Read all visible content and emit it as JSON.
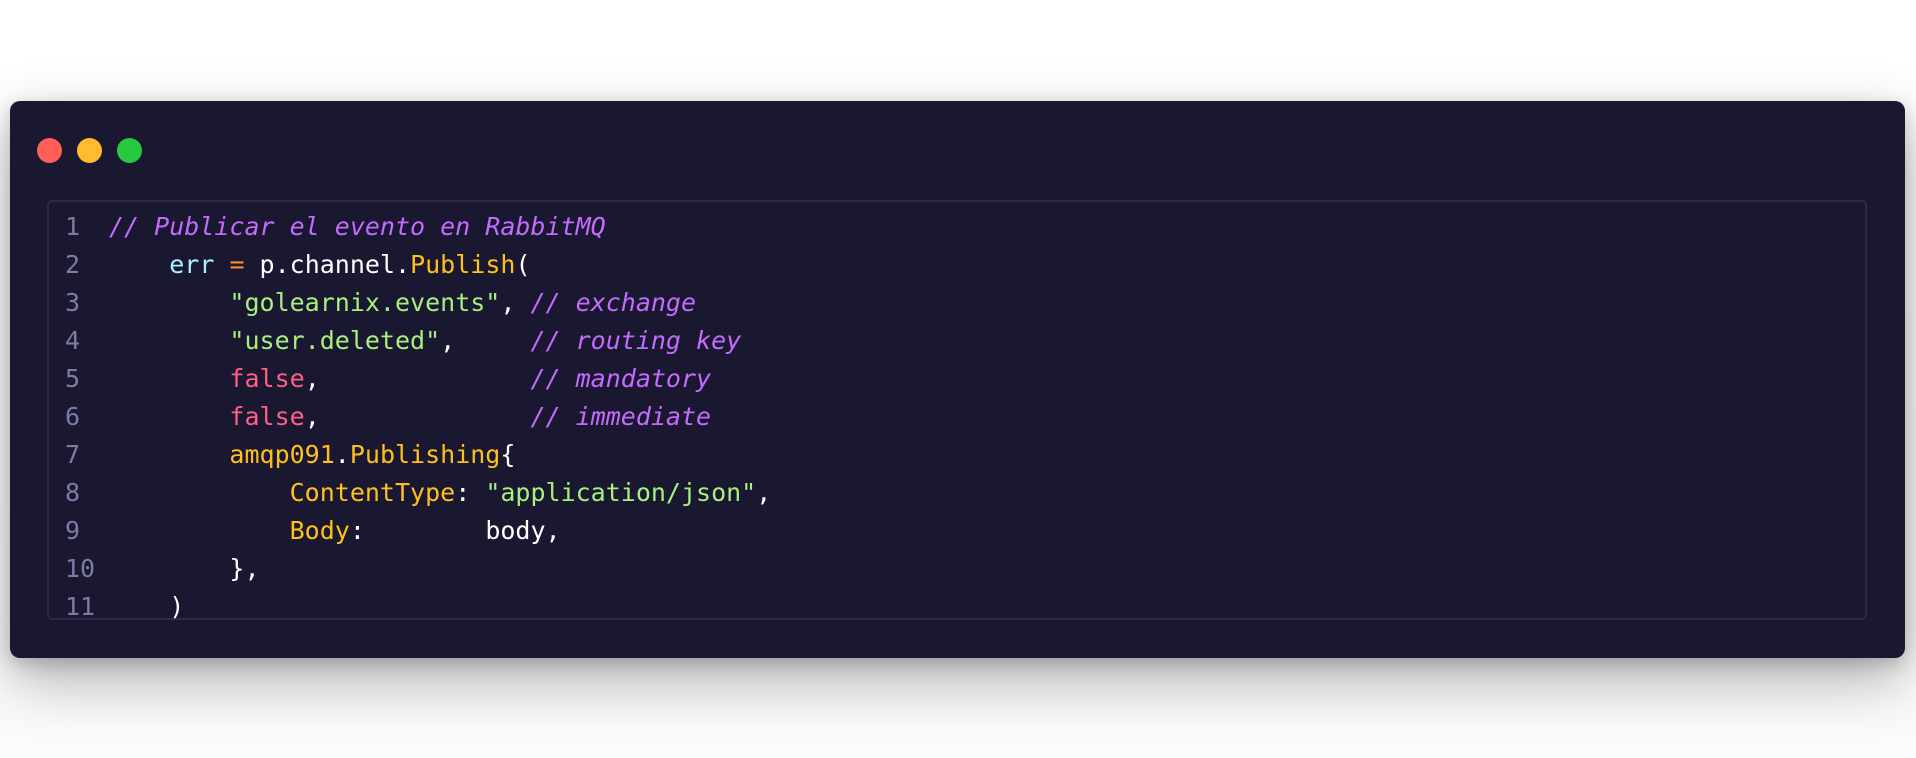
{
  "window": {
    "controls": [
      {
        "name": "close",
        "color": "#ff5f57"
      },
      {
        "name": "minimize",
        "color": "#febc2e"
      },
      {
        "name": "maximize",
        "color": "#28c840"
      }
    ]
  },
  "colors": {
    "background": "#1a1830",
    "comment": "#c36bff",
    "string": "#a8ef7d",
    "keyword_bool": "#ff5f86",
    "function": "#ffc01e",
    "variable": "#a8f0ff",
    "operator": "#ff8a2b",
    "line_number": "#7d7aa6"
  },
  "code": {
    "lines": [
      {
        "number": "1",
        "tokens": [
          {
            "type": "comment",
            "text": "// Publicar el evento en RabbitMQ"
          }
        ]
      },
      {
        "number": "2",
        "tokens": [
          {
            "type": "plain",
            "text": "    "
          },
          {
            "type": "var",
            "text": "err"
          },
          {
            "type": "plain",
            "text": " "
          },
          {
            "type": "op",
            "text": "="
          },
          {
            "type": "plain",
            "text": " p.channel."
          },
          {
            "type": "func",
            "text": "Publish"
          },
          {
            "type": "punct",
            "text": "("
          }
        ]
      },
      {
        "number": "3",
        "tokens": [
          {
            "type": "plain",
            "text": "        "
          },
          {
            "type": "str",
            "text": "\"golearnix.events\""
          },
          {
            "type": "punct",
            "text": ", "
          },
          {
            "type": "comment",
            "text": "// exchange"
          }
        ]
      },
      {
        "number": "4",
        "tokens": [
          {
            "type": "plain",
            "text": "        "
          },
          {
            "type": "str",
            "text": "\"user.deleted\""
          },
          {
            "type": "punct",
            "text": ",     "
          },
          {
            "type": "comment",
            "text": "// routing key"
          }
        ]
      },
      {
        "number": "5",
        "tokens": [
          {
            "type": "plain",
            "text": "        "
          },
          {
            "type": "bool",
            "text": "false"
          },
          {
            "type": "punct",
            "text": ",              "
          },
          {
            "type": "comment",
            "text": "// mandatory"
          }
        ]
      },
      {
        "number": "6",
        "tokens": [
          {
            "type": "plain",
            "text": "        "
          },
          {
            "type": "bool",
            "text": "false"
          },
          {
            "type": "punct",
            "text": ",              "
          },
          {
            "type": "comment",
            "text": "// immediate"
          }
        ]
      },
      {
        "number": "7",
        "tokens": [
          {
            "type": "plain",
            "text": "        "
          },
          {
            "type": "func",
            "text": "amqp091"
          },
          {
            "type": "punct",
            "text": "."
          },
          {
            "type": "func",
            "text": "Publishing"
          },
          {
            "type": "punct",
            "text": "{"
          }
        ]
      },
      {
        "number": "8",
        "tokens": [
          {
            "type": "plain",
            "text": "            "
          },
          {
            "type": "field",
            "text": "ContentType"
          },
          {
            "type": "punct",
            "text": ": "
          },
          {
            "type": "str",
            "text": "\"application/json\""
          },
          {
            "type": "punct",
            "text": ","
          }
        ]
      },
      {
        "number": "9",
        "tokens": [
          {
            "type": "plain",
            "text": "            "
          },
          {
            "type": "field",
            "text": "Body"
          },
          {
            "type": "punct",
            "text": ":        "
          },
          {
            "type": "plain",
            "text": "body,"
          }
        ]
      },
      {
        "number": "10",
        "tokens": [
          {
            "type": "plain",
            "text": "        "
          },
          {
            "type": "punct",
            "text": "},"
          }
        ]
      },
      {
        "number": "11",
        "tokens": [
          {
            "type": "plain",
            "text": "    "
          },
          {
            "type": "punct",
            "text": ")"
          }
        ]
      }
    ]
  }
}
